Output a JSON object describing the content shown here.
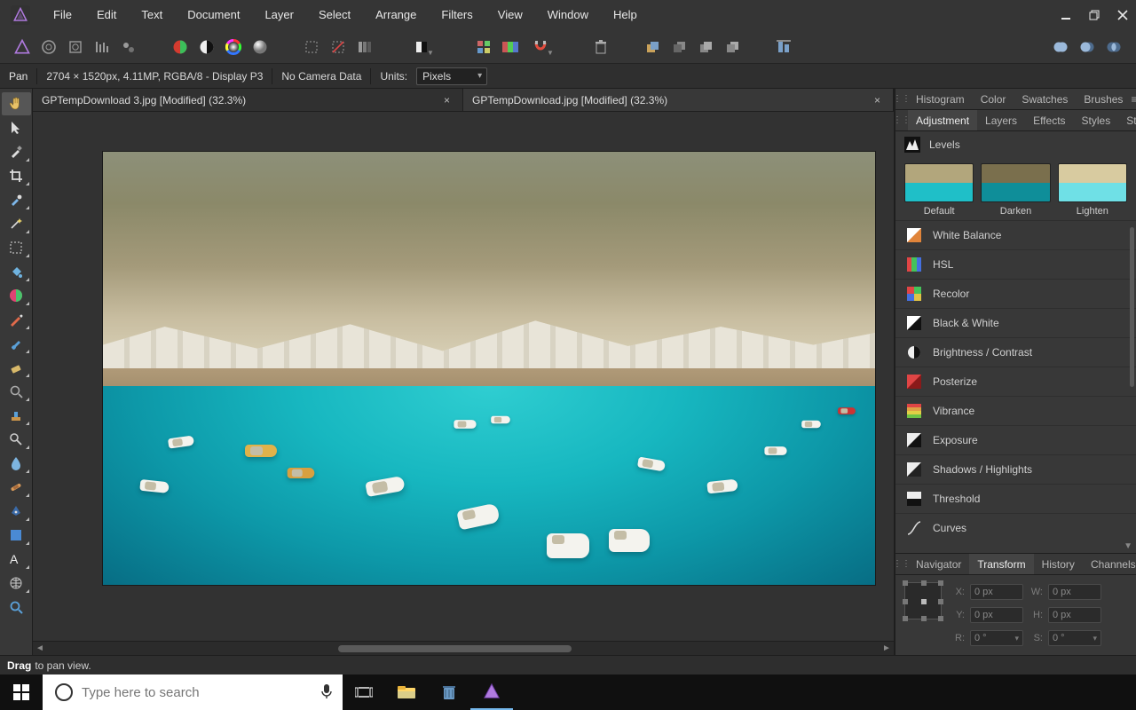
{
  "menu": {
    "items": [
      "File",
      "Edit",
      "Text",
      "Document",
      "Layer",
      "Select",
      "Arrange",
      "Filters",
      "View",
      "Window",
      "Help"
    ]
  },
  "context": {
    "tool": "Pan",
    "info": "2704 × 1520px, 4.11MP, RGBA/8 - Display P3",
    "camera": "No Camera Data",
    "units_label": "Units:",
    "units_value": "Pixels"
  },
  "tabs": [
    {
      "title": "GPTempDownload 3.jpg [Modified] (32.3%)",
      "active": true
    },
    {
      "title": "GPTempDownload.jpg [Modified] (32.3%)",
      "active": false
    }
  ],
  "studio_top": {
    "tabs": [
      "Histogram",
      "Color",
      "Swatches",
      "Brushes"
    ],
    "active": -1
  },
  "studio_mid": {
    "tabs": [
      "Adjustment",
      "Layers",
      "Effects",
      "Styles",
      "Stock"
    ],
    "active": 0
  },
  "adjustment": {
    "heading": "Levels",
    "presets": [
      {
        "label": "Default"
      },
      {
        "label": "Darken"
      },
      {
        "label": "Lighten"
      }
    ],
    "items": [
      "White Balance",
      "HSL",
      "Recolor",
      "Black & White",
      "Brightness / Contrast",
      "Posterize",
      "Vibrance",
      "Exposure",
      "Shadows / Highlights",
      "Threshold",
      "Curves"
    ]
  },
  "studio_bot": {
    "tabs": [
      "Navigator",
      "Transform",
      "History",
      "Channels"
    ],
    "active": 1
  },
  "transform": {
    "X": "0 px",
    "Y": "0 px",
    "W": "0 px",
    "H": "0 px",
    "R": "0 °",
    "S": "0 °"
  },
  "hint": {
    "bold": "Drag",
    "rest": "to pan view."
  },
  "taskbar": {
    "search_placeholder": "Type here to search"
  }
}
